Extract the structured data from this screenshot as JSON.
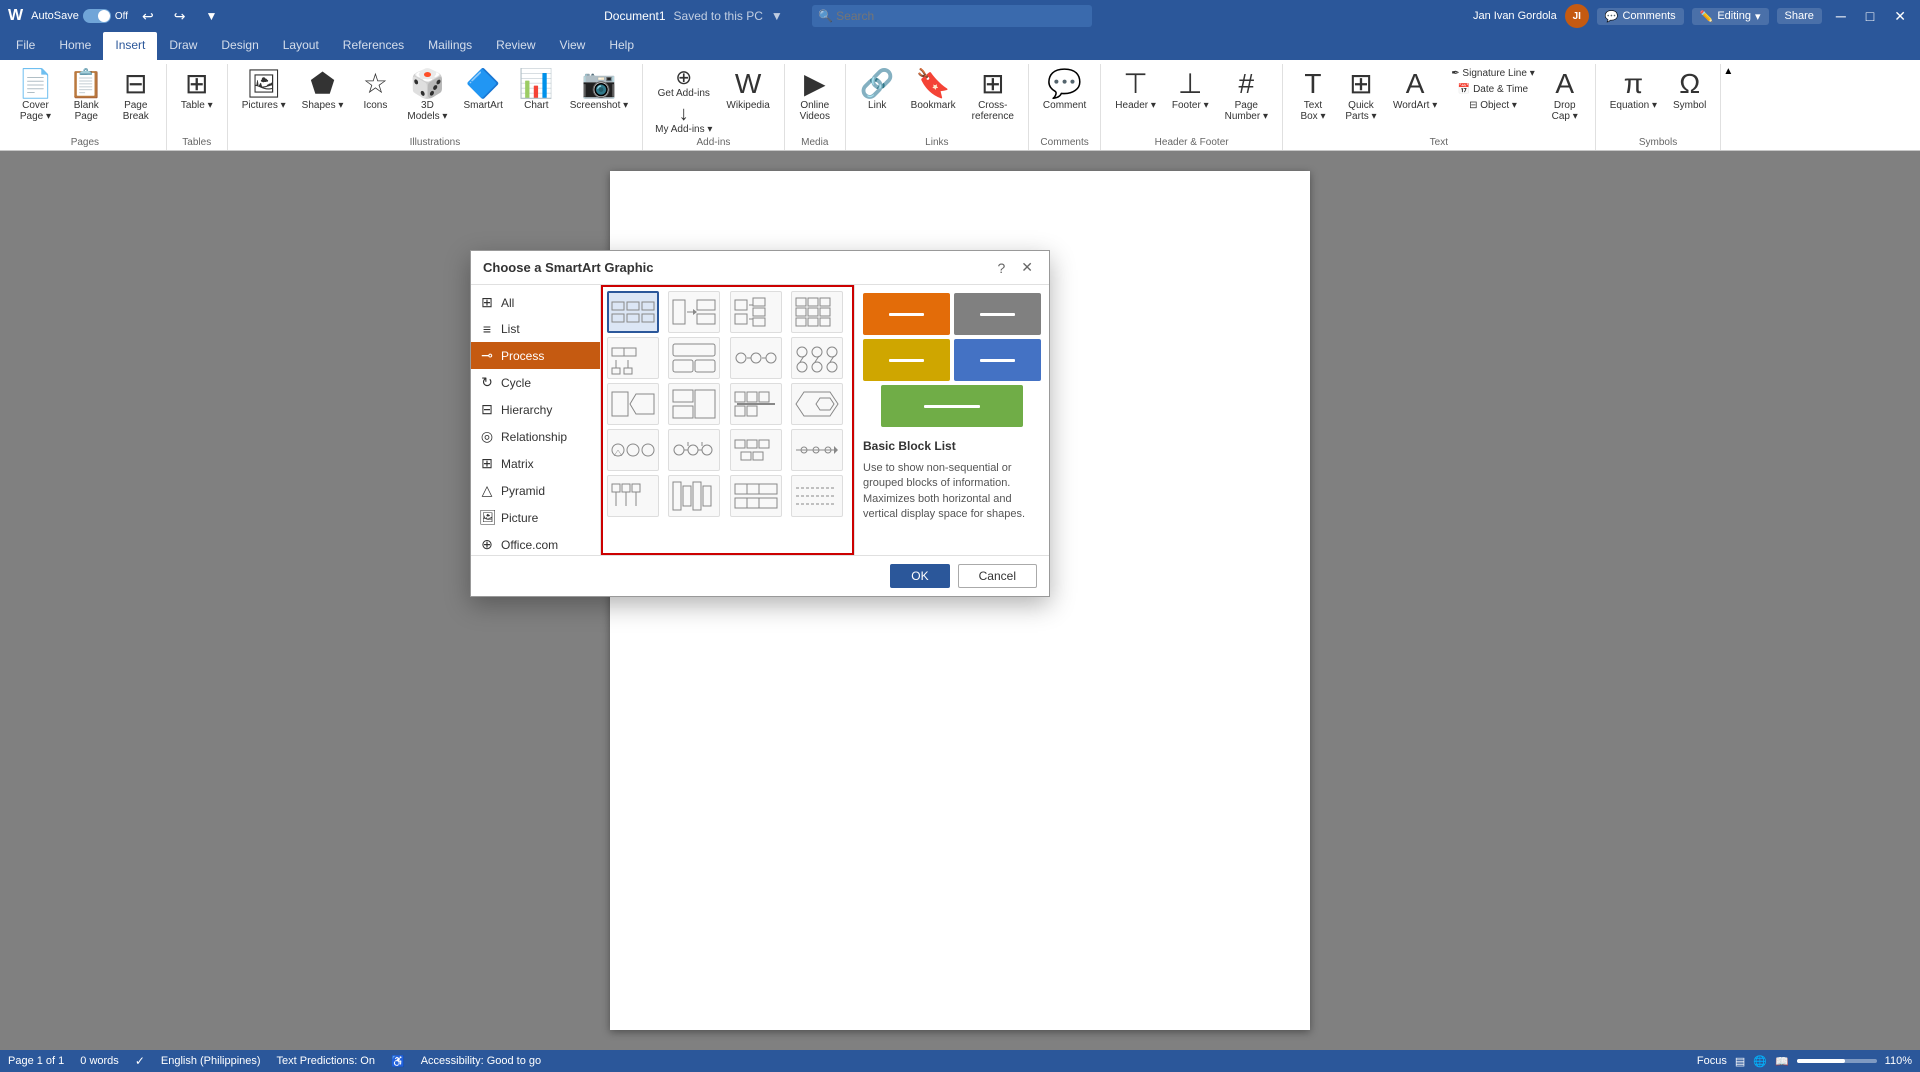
{
  "titlebar": {
    "autosave_label": "AutoSave",
    "toggle_state": "Off",
    "document_name": "Document1",
    "save_status": "Saved to this PC",
    "search_placeholder": "Search",
    "user_name": "Jan Ivan Gordola",
    "user_initials": "JI",
    "editing_label": "Editing",
    "share_label": "Share",
    "comments_label": "Comments"
  },
  "ribbon": {
    "tabs": [
      "File",
      "Home",
      "Insert",
      "Draw",
      "Design",
      "Layout",
      "References",
      "Mailings",
      "Review",
      "View",
      "Help"
    ],
    "active_tab": "Insert",
    "groups": {
      "pages": {
        "label": "Pages",
        "items": [
          "Cover Page",
          "Blank Page",
          "Page Break"
        ]
      },
      "tables": {
        "label": "Tables",
        "items": [
          "Table"
        ]
      },
      "illustrations": {
        "label": "Illustrations",
        "items": [
          "Pictures",
          "Shapes",
          "Icons",
          "3D Models",
          "SmartArt",
          "Chart",
          "Screenshot"
        ]
      },
      "addins": {
        "label": "Add-ins",
        "items": [
          "Get Add-ins",
          "My Add-ins",
          "Wikipedia"
        ]
      },
      "media": {
        "label": "Media",
        "items": [
          "Online Videos"
        ]
      },
      "links": {
        "label": "Links",
        "items": [
          "Link",
          "Bookmark",
          "Cross-reference"
        ]
      },
      "comments": {
        "label": "Comments",
        "items": [
          "Comment"
        ]
      },
      "header_footer": {
        "label": "Header & Footer",
        "items": [
          "Header",
          "Footer",
          "Page Number"
        ]
      },
      "text": {
        "label": "Text",
        "items": [
          "Text Box",
          "Quick Parts",
          "WordArt",
          "Drop Cap",
          "Signature Line",
          "Date & Time",
          "Object"
        ]
      },
      "symbols": {
        "label": "Symbols",
        "items": [
          "Equation",
          "Symbol"
        ]
      }
    }
  },
  "dialog": {
    "title": "Choose a SmartArt Graphic",
    "categories": [
      {
        "id": "all",
        "label": "All",
        "icon": "⊞"
      },
      {
        "id": "list",
        "label": "List",
        "icon": "≡"
      },
      {
        "id": "process",
        "label": "Process",
        "icon": "⊸"
      },
      {
        "id": "cycle",
        "label": "Cycle",
        "icon": "↻"
      },
      {
        "id": "hierarchy",
        "label": "Hierarchy",
        "icon": "⊟"
      },
      {
        "id": "relationship",
        "label": "Relationship",
        "icon": "◎"
      },
      {
        "id": "matrix",
        "label": "Matrix",
        "icon": "⊞"
      },
      {
        "id": "pyramid",
        "label": "Pyramid",
        "icon": "△"
      },
      {
        "id": "picture",
        "label": "Picture",
        "icon": "🖼"
      },
      {
        "id": "office",
        "label": "Office.com",
        "icon": "⊕"
      }
    ],
    "selected_category": "process",
    "preview": {
      "title": "Basic Block List",
      "description": "Use to show non-sequential or grouped blocks of information. Maximizes both horizontal and vertical display space for shapes.",
      "colors": {
        "orange": "#E36C09",
        "gray": "#808080",
        "yellow": "#CFA600",
        "blue": "#4472C4",
        "green": "#70AD47"
      }
    },
    "buttons": {
      "ok": "OK",
      "cancel": "Cancel"
    }
  },
  "statusbar": {
    "page": "Page 1 of 1",
    "words": "0 words",
    "language": "English (Philippines)",
    "text_predictions": "Text Predictions: On",
    "accessibility": "Accessibility: Good to go",
    "focus": "Focus",
    "zoom": "110%"
  }
}
